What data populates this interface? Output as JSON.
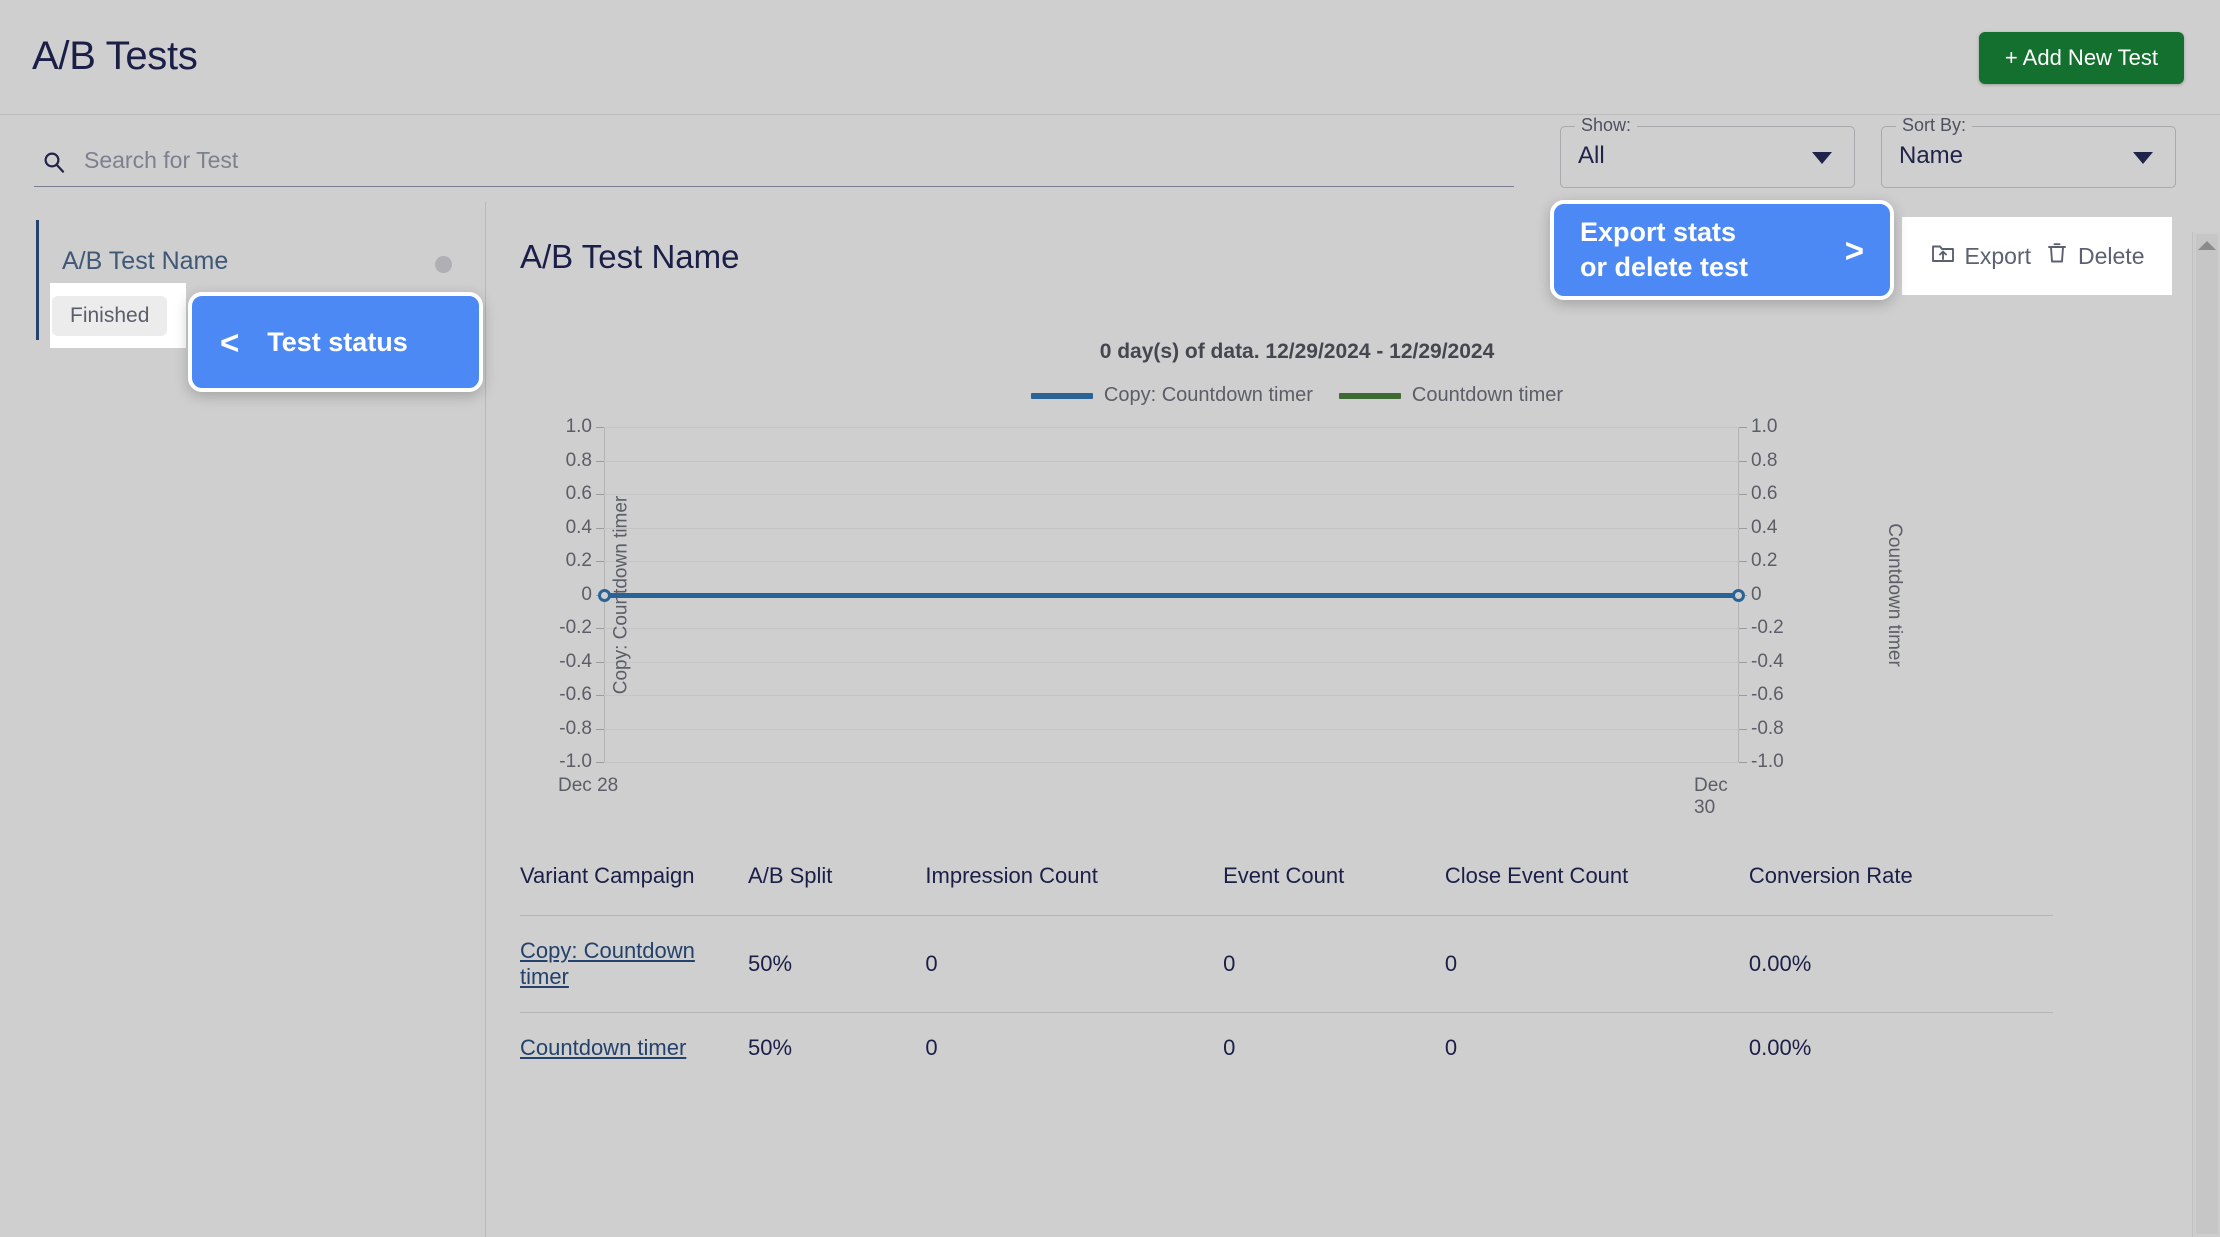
{
  "header": {
    "title": "A/B Tests",
    "add_button_label": "+ Add New Test",
    "accent_green": "#14702e",
    "title_color": "#1b1f48"
  },
  "filters": {
    "search_placeholder": "Search for Test",
    "search_value": "",
    "search_icon": "search-icon",
    "show": {
      "legend": "Show:",
      "value": "All"
    },
    "sort_by": {
      "legend": "Sort By:",
      "value": "Name"
    }
  },
  "sidebar": {
    "items": [
      {
        "name": "A/B Test Name",
        "status": "Finished",
        "status_dot_color": "#b0b0b4",
        "selected": true
      }
    ]
  },
  "main": {
    "title": "A/B Test Name",
    "actions": [
      {
        "label": "Export",
        "icon": "folder-upload-icon"
      },
      {
        "label": "Delete",
        "icon": "trash-icon"
      }
    ]
  },
  "chart_data": {
    "type": "line",
    "title": "0 day(s) of data. 12/29/2024 - 12/29/2024",
    "xlabel": "",
    "ylabel": "Copy: Countdown timer",
    "ylabel_right": "Countdown timer",
    "ylim": [
      -1.0,
      1.0
    ],
    "yticks": [
      "1.0",
      "0.8",
      "0.6",
      "0.4",
      "0.2",
      "0",
      "-0.2",
      "-0.4",
      "-0.6",
      "-0.8",
      "-1.0"
    ],
    "yticks_right": [
      "1.0",
      "0.8",
      "0.6",
      "0.4",
      "0.2",
      "0",
      "-0.2",
      "-0.4",
      "-0.6",
      "-0.8",
      "-1.0"
    ],
    "xticks": [
      "Dec 28",
      "Dec 30"
    ],
    "grid": true,
    "legend_position": "top",
    "series": [
      {
        "name": "Copy: Countdown timer",
        "color": "#2a6496",
        "x": [
          "Dec 28",
          "Dec 30"
        ],
        "values": [
          0,
          0
        ]
      },
      {
        "name": "Countdown timer",
        "color": "#3d6b33",
        "x": [
          "Dec 28",
          "Dec 30"
        ],
        "values": [
          0,
          0
        ]
      }
    ]
  },
  "table": {
    "headers": [
      "Variant Campaign",
      "A/B Split",
      "Impression Count",
      "Event Count",
      "Close Event Count",
      "Conversion Rate"
    ],
    "rows": [
      {
        "variant": "Copy: Countdown timer",
        "split": "50%",
        "impressions": "0",
        "events": "0",
        "close_events": "0",
        "conversion": "0.00%"
      },
      {
        "variant": "Countdown timer",
        "split": "50%",
        "impressions": "0",
        "events": "0",
        "close_events": "0",
        "conversion": "0.00%"
      }
    ]
  },
  "tour": {
    "accent_blue": "#4d89f5",
    "status_callout": {
      "arrow": "<",
      "text": "Test status"
    },
    "export_callout": {
      "arrow": ">",
      "text": "Export stats\nor delete test"
    }
  }
}
